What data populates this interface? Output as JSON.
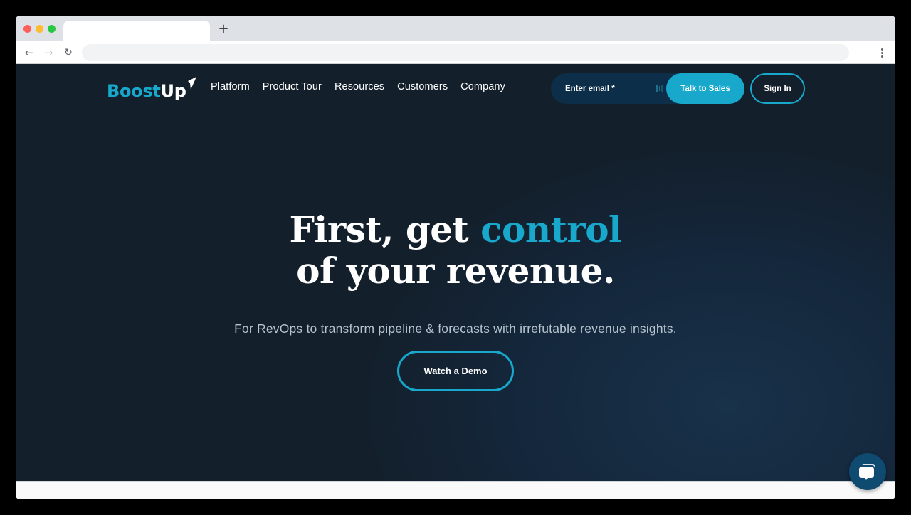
{
  "browser": {
    "tab_title": "",
    "new_tab_label": "+",
    "back_icon": "arrow-left-icon",
    "forward_icon": "arrow-right-icon",
    "reload_icon": "reload-icon",
    "menu_icon": "vertical-dots-icon",
    "address": ""
  },
  "header": {
    "logo": {
      "part1": "Boost",
      "part2": "Up"
    },
    "nav": [
      "Platform",
      "Product Tour",
      "Resources",
      "Customers",
      "Company"
    ],
    "email_placeholder": "Enter email *",
    "email_value": "",
    "talk_to_sales": "Talk to Sales",
    "sign_in": "Sign In"
  },
  "hero": {
    "title_line1_prefix": "First, get ",
    "title_line1_accent": "control",
    "title_line2": "of your revenue.",
    "subtitle": "For RevOps to transform pipeline & forecasts with irrefutable revenue insights.",
    "cta": "Watch a Demo"
  },
  "chat": {
    "icon": "chat-bubbles-icon"
  },
  "colors": {
    "accent": "#17a8cc",
    "background": "#131f2b",
    "email_field": "#0c2e48",
    "chat_button": "#0f4a70"
  }
}
